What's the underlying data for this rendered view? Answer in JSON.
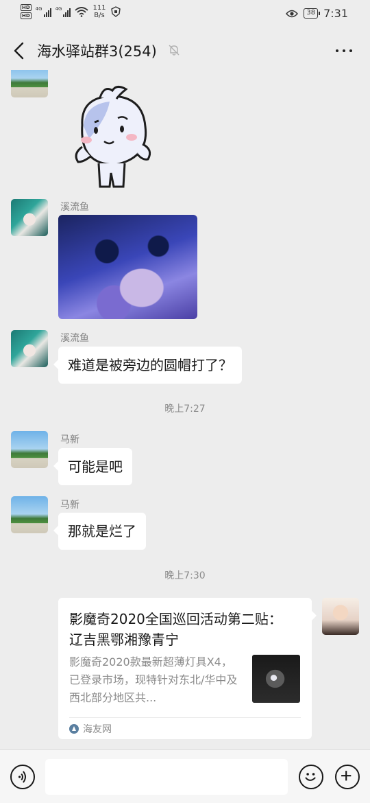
{
  "status_bar": {
    "hd_top": "HD",
    "hd_bottom": "HD",
    "network_1": "4G",
    "network_2": "4G",
    "speed_value": "111",
    "speed_unit": "B/s",
    "battery": "38",
    "time": "7:31"
  },
  "header": {
    "title": "海水驿站群3(254)",
    "icons": [
      "back-arrow-icon",
      "mute-bell-icon",
      "more-icon"
    ]
  },
  "messages": [
    {
      "type": "sticker",
      "avatar": "sky-avatar"
    },
    {
      "type": "image",
      "sender": "溪流鱼",
      "avatar": "anime-avatar"
    },
    {
      "type": "text",
      "sender": "溪流鱼",
      "text": "难道是被旁边的圆帽打了？",
      "avatar": "anime-avatar"
    },
    {
      "type": "time",
      "text": "晚上7:27"
    },
    {
      "type": "text",
      "sender": "马新",
      "text": "可能是吧",
      "avatar": "sky-avatar"
    },
    {
      "type": "text",
      "sender": "马新",
      "text": "那就是烂了",
      "avatar": "sky-avatar"
    },
    {
      "type": "time",
      "text": "晚上7:30"
    },
    {
      "type": "link",
      "avatar": "kid-avatar",
      "title": "影魔奇2020全国巡回活动第二贴： 辽吉黑鄂湘豫青宁",
      "description": "影魔奇2020款最新超薄灯具X4，已登录市场，现特针对东北/华中及西北部分地区共...",
      "source": "海友网"
    }
  ],
  "input_bar": {
    "icons": [
      "voice-icon",
      "emoji-icon",
      "plus-icon"
    ]
  }
}
